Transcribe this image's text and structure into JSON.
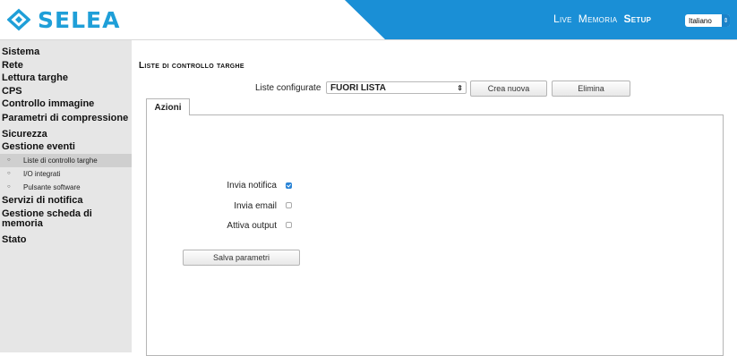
{
  "brand": {
    "name": "SELEA"
  },
  "topnav": {
    "live": "Live",
    "memoria": "Memoria",
    "setup": "Setup"
  },
  "language": {
    "selected": "Italiano"
  },
  "sidebar": {
    "items": [
      "Sistema",
      "Rete",
      "Lettura targhe",
      "CPS",
      "Controllo immagine",
      "Parametri di compressione",
      "Sicurezza",
      "Gestione eventi"
    ],
    "subitems": [
      "Liste di controllo targhe",
      "I/O integrati",
      "Pulsante software"
    ],
    "items_after": [
      "Servizi di notifica",
      "Gestione scheda di memoria",
      "Stato"
    ]
  },
  "main": {
    "title": "Liste di controllo targhe",
    "configured_label": "Liste configurate",
    "configured_value": "FUORI LISTA",
    "create_button": "Crea nuova",
    "delete_button": "Elimina",
    "tab_label": "Azioni",
    "options": [
      {
        "label": "Invia notifica",
        "checked": true
      },
      {
        "label": "Invia email",
        "checked": false
      },
      {
        "label": "Attiva output",
        "checked": false
      }
    ],
    "save_button": "Salva parametri"
  },
  "colors": {
    "brand_blue": "#1f9fd8",
    "header_blue": "#1a8fd6",
    "sidebar_bg": "#e6e6e6"
  }
}
